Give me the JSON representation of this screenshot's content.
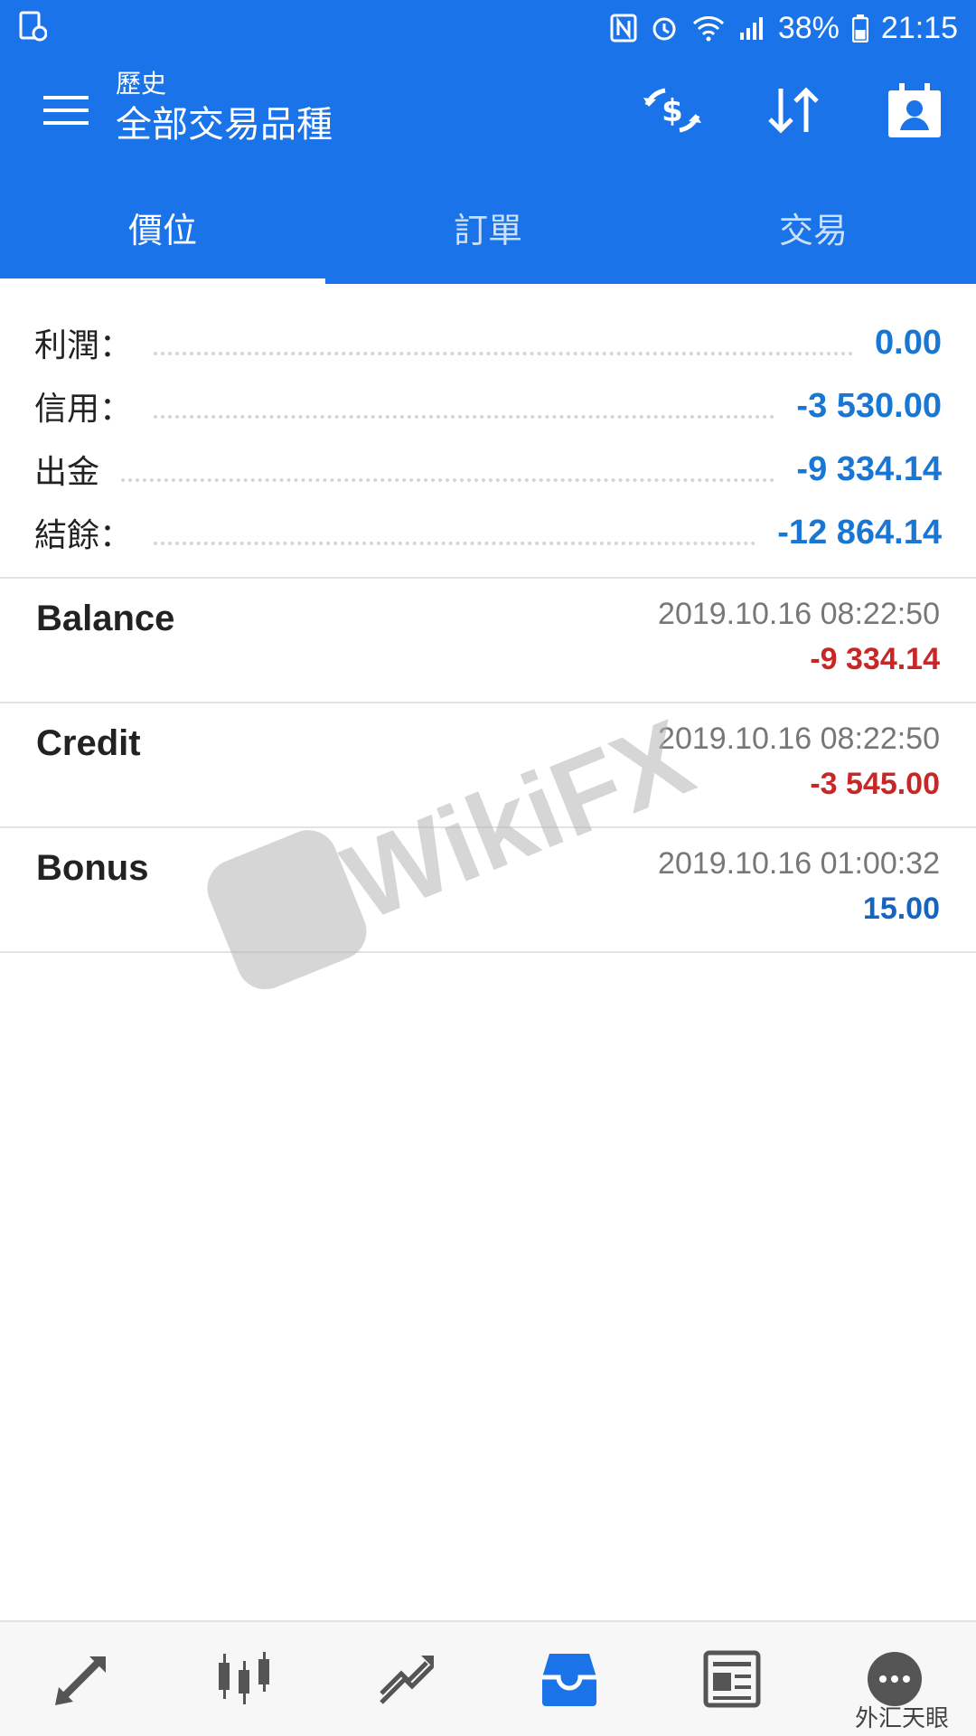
{
  "status_bar": {
    "battery": "38%",
    "time": "21:15",
    "icons": [
      "screenshot-icon",
      "nfc-icon",
      "alarm-icon",
      "wifi-icon",
      "signal-icon",
      "battery-icon"
    ]
  },
  "app_bar": {
    "subtitle": "歷史",
    "title": "全部交易品種",
    "actions": [
      "currency-exchange-icon",
      "sort-icon",
      "contacts-icon"
    ]
  },
  "tabs": [
    {
      "label": "價位",
      "active": true
    },
    {
      "label": "訂單",
      "active": false
    },
    {
      "label": "交易",
      "active": false
    }
  ],
  "summary": [
    {
      "label": "利潤：",
      "value": "0.00"
    },
    {
      "label": "信用：",
      "value": "-3 530.00"
    },
    {
      "label": "出金",
      "value": "-9 334.14"
    },
    {
      "label": "結餘：",
      "value": "-12 864.14"
    }
  ],
  "deals": [
    {
      "name": "Balance",
      "time": "2019.10.16 08:22:50",
      "amount": "-9 334.14",
      "sign": "neg"
    },
    {
      "name": "Credit",
      "time": "2019.10.16 08:22:50",
      "amount": "-3 545.00",
      "sign": "neg"
    },
    {
      "name": "Bonus",
      "time": "2019.10.16 01:00:32",
      "amount": "15.00",
      "sign": "pos"
    }
  ],
  "watermark": {
    "text": "WikiFX"
  },
  "bottom_nav": [
    "trade-arrows-icon",
    "candlestick-icon",
    "chart-trend-icon",
    "history-inbox-icon",
    "news-icon",
    "chat-icon"
  ],
  "wechat_label": "外汇天眼",
  "colors": {
    "primary": "#1a73e8",
    "negative": "#c62828",
    "positive": "#1565c0"
  }
}
